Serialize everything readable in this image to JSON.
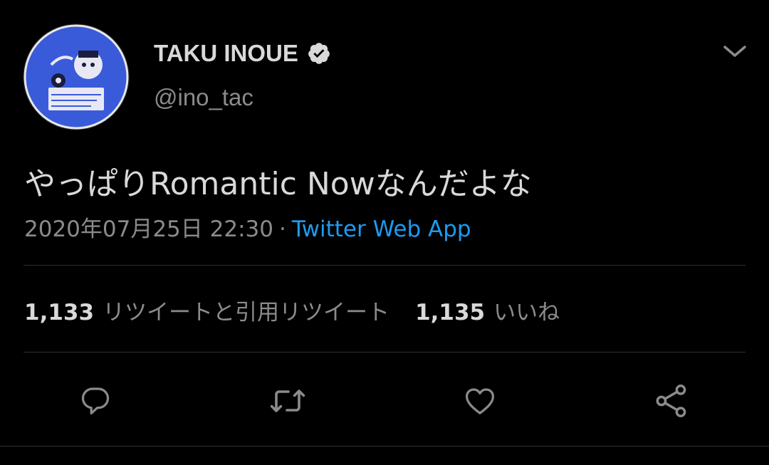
{
  "tweet": {
    "author": {
      "display_name": "TAKU INOUE",
      "handle": "@ino_tac",
      "verified": true,
      "avatar_icon": "record-label-avatar-icon"
    },
    "text": "やっぱりRomantic Nowなんだよな",
    "timestamp": "2020年07月25日 22:30",
    "separator": "·",
    "source": "Twitter Web App",
    "stats": {
      "retweets_count": "1,133",
      "retweets_label": "リツイートと引用リツイート",
      "likes_count": "1,135",
      "likes_label": "いいね"
    },
    "actions": [
      {
        "name": "reply",
        "icon": "reply-icon"
      },
      {
        "name": "retweet",
        "icon": "retweet-icon"
      },
      {
        "name": "like",
        "icon": "heart-icon"
      },
      {
        "name": "share",
        "icon": "share-icon"
      }
    ],
    "colors": {
      "background": "#000000",
      "text_primary": "#d9d9d9",
      "text_secondary": "#8b8b8b",
      "link": "#1d9bf0",
      "divider": "#2f2f2f",
      "avatar_blue": "#3a5bd9"
    }
  }
}
